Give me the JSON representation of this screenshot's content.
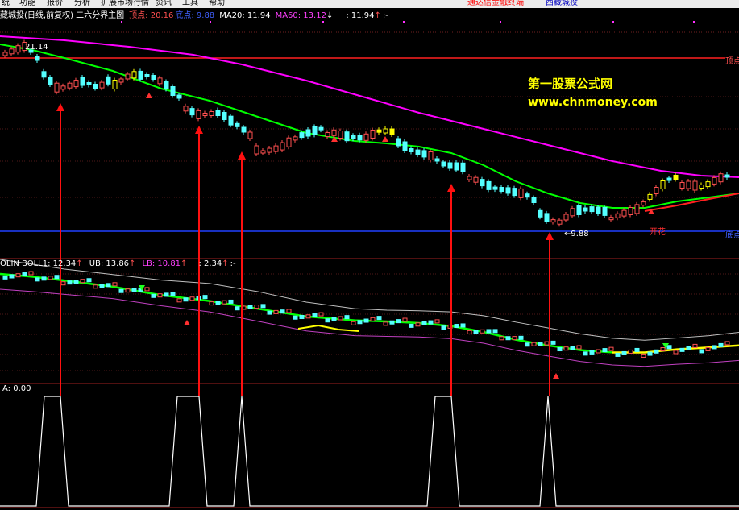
{
  "menu": {
    "items": [
      "统",
      "功能",
      "报价",
      "分析",
      "扩展市场行情",
      "资讯",
      "工具",
      "帮助"
    ],
    "notice": "通达信金融终端",
    "stock_link": "西藏城投"
  },
  "main_header": {
    "title": "藏城投(日线,前复权) 二六分界主图",
    "top_label": "顶点: 20.16",
    "bottom_label": "底点: 9.88",
    "ma20": "MA20: 11.94",
    "ma60": "MA60: 13.12",
    "ma60_arrow": "↓",
    "extra": ": 11.94",
    "extra_arrow": "↑",
    "extra_dash": ":-"
  },
  "boll_header": {
    "title": "OLIN  BOLL1: 12.34",
    "boll_arrow": "↑",
    "ub": "UB: 13.86",
    "ub_arrow": "↑",
    "lb": "LB: 10.81",
    "lb_arrow": "↑",
    "extra": ": 2.34",
    "extra_arrow": "↑",
    "extra_dash": ":-"
  },
  "sub_header": {
    "label": "A: 0.00"
  },
  "annotations": {
    "high_price": "21.14",
    "low_price": "←9.88",
    "top_level": "顶点",
    "bottom_level": "底点",
    "kaihua": "开花"
  },
  "watermark": {
    "line1": "第一股票公式网",
    "line2": "www.chnmoney.com"
  },
  "colors": {
    "up_candle": "#ff5050",
    "down_candle": "#54ffff",
    "signal_candle": "#ffff00",
    "ma20": "#00ff00",
    "ma60": "#ff00ff",
    "red_line": "#ff2020",
    "bottom_level": "#2040ff",
    "boll_upper": "#c0c0c0",
    "boll_lower": "#c040c0"
  }
}
